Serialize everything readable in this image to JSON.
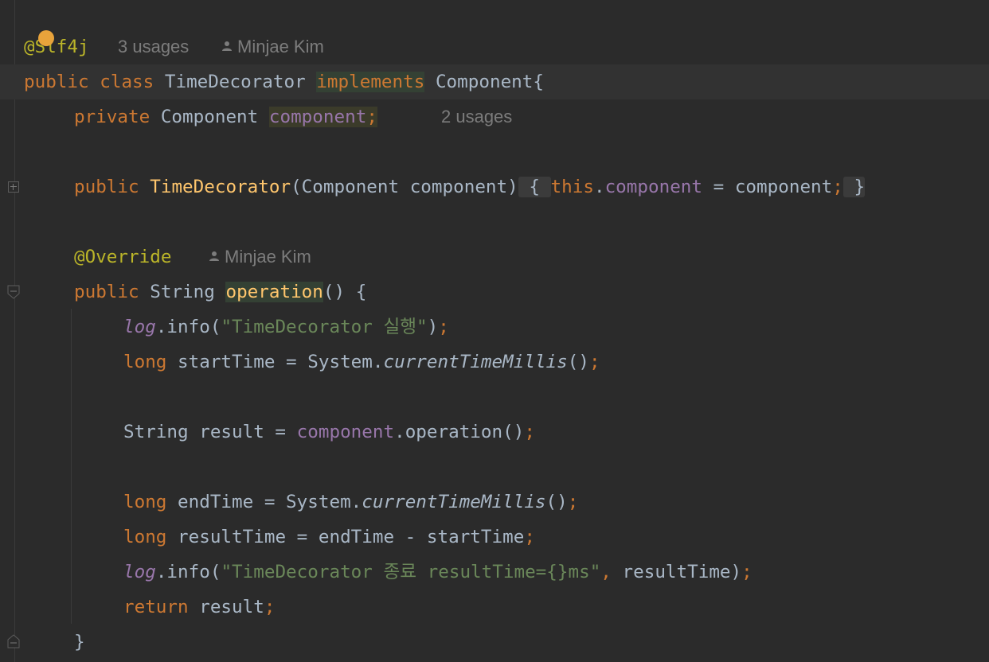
{
  "editor": {
    "annotation_line": {
      "annotation": "@Slf4j",
      "usages": "3 usages",
      "author": "Minjae Kim"
    },
    "lines": {
      "l2": {
        "kw_public": "public",
        "kw_class": "class",
        "name": "TimeDecorator",
        "kw_implements": "implements",
        "iface": "Component",
        "brace": "{"
      },
      "l3": {
        "kw_private": "private",
        "type": "Component",
        "field": "component",
        "semi": ";",
        "usages": "2 usages"
      },
      "l5": {
        "kw_public": "public",
        "ctor": "TimeDecorator",
        "params": "(Component component)",
        "open": " { ",
        "kw_this": "this",
        "dot": ".",
        "field": "component",
        "assign": " = component",
        "semi": ";",
        "close": " }"
      },
      "l7": {
        "annotation": "@Override",
        "author": "Minjae Kim"
      },
      "l8": {
        "kw_public": "public",
        "type": "String",
        "method": "operation",
        "rest": "() {"
      },
      "l9": {
        "log": "log",
        "call": ".info(",
        "str": "\"TimeDecorator 실행\"",
        "close": ")",
        "semi": ";"
      },
      "l10": {
        "kw_long": "long",
        "decl": " startTime = System.",
        "static": "currentTimeMillis",
        "call": "()",
        "semi": ";"
      },
      "l12": {
        "decl": "String result = ",
        "field": "component",
        "call": ".operation()",
        "semi": ";"
      },
      "l14": {
        "kw_long": "long",
        "decl": " endTime = System.",
        "static": "currentTimeMillis",
        "call": "()",
        "semi": ";"
      },
      "l15": {
        "kw_long": "long",
        "decl": " resultTime = endTime - startTime",
        "semi": ";"
      },
      "l16": {
        "log": "log",
        "call": ".info(",
        "str": "\"TimeDecorator 종료 resultTime={}ms\"",
        "comma": ",",
        "arg": " resultTime)",
        "semi": ";"
      },
      "l17": {
        "kw_return": "return",
        "decl": " result",
        "semi": ";"
      },
      "l18": {
        "brace": "}"
      }
    }
  }
}
